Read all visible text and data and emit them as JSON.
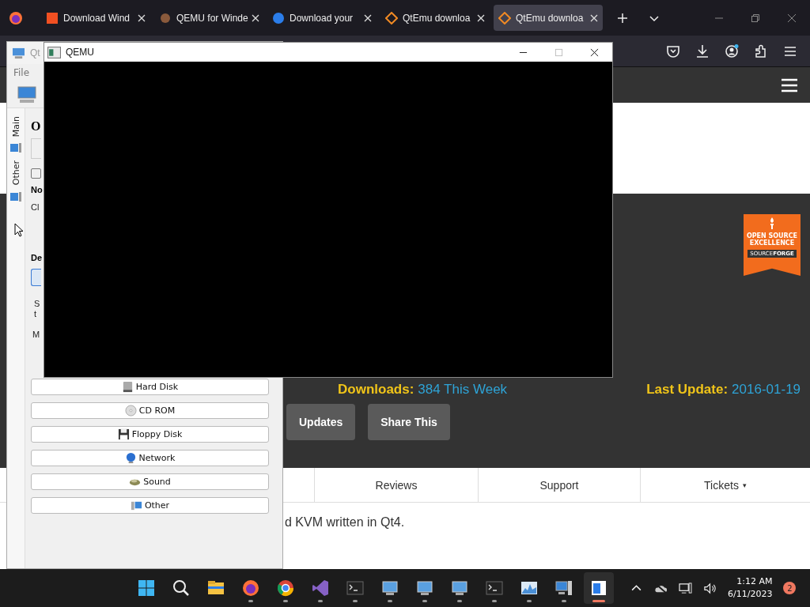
{
  "browser": {
    "tabs": [
      {
        "title": "Download Wind",
        "selected": false
      },
      {
        "title": "QEMU for Winde",
        "selected": false
      },
      {
        "title": "Download your",
        "selected": false
      },
      {
        "title": "QtEmu downloa",
        "selected": false
      },
      {
        "title": "QtEmu downloa",
        "selected": true
      }
    ]
  },
  "page": {
    "badge": {
      "title": "OPEN SOURCE EXCELLENCE",
      "brand": "SOURCE**FORGE**"
    },
    "downloads_label": "Downloads:",
    "downloads_value": "384 This Week",
    "last_update_label": "Last Update:",
    "last_update_value": "2016-01-19",
    "buttons": [
      "Updates",
      "Share This"
    ],
    "nav": [
      {
        "label": "Reviews",
        "dropdown": false
      },
      {
        "label": "Support",
        "dropdown": false
      },
      {
        "label": "Tickets",
        "dropdown": true
      }
    ],
    "dropdown_mark": "▾",
    "description": "d KVM written in Qt4."
  },
  "qtemu": {
    "title": "Qt",
    "menu": [
      "File"
    ],
    "checkbox_checked": false,
    "side_tabs": [
      "Main",
      "Other"
    ],
    "heading": "O",
    "section_1": "No",
    "line_1": "Cl",
    "section_2": "De",
    "line_2": "S",
    "line_3": "t",
    "line_4": "M",
    "devices": [
      "Hard Disk",
      "CD ROM",
      "Floppy Disk",
      "Network",
      "Sound",
      "Other"
    ]
  },
  "qemu": {
    "title": "QEMU"
  },
  "taskbar": {
    "apps": [
      {
        "selected": false
      },
      {
        "selected": false
      },
      {
        "selected": false
      },
      {
        "selected": false
      },
      {
        "selected": false
      },
      {
        "selected": false
      },
      {
        "selected": false
      },
      {
        "selected": false
      },
      {
        "selected": false
      },
      {
        "selected": false
      },
      {
        "selected": false
      },
      {
        "selected": false
      },
      {
        "selected": false
      },
      {
        "selected": true
      }
    ],
    "time": "1:12 AM",
    "date": "6/11/2023",
    "notifications": "2"
  }
}
